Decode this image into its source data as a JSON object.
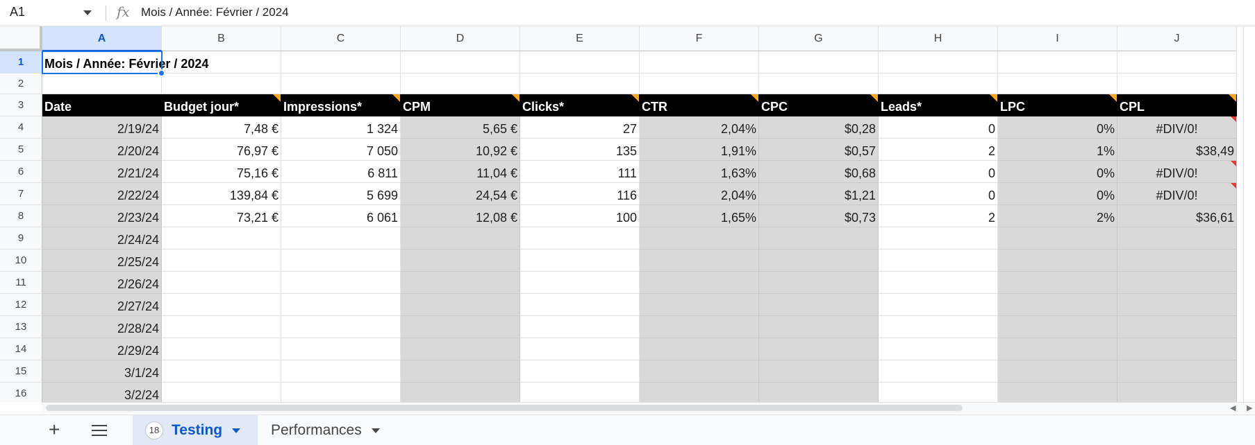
{
  "formula_bar": {
    "name_box": "A1",
    "fx_label": "fx",
    "formula": "Mois / Année: Février / 2024"
  },
  "columns": [
    "A",
    "B",
    "C",
    "D",
    "E",
    "F",
    "G",
    "H",
    "I",
    "J"
  ],
  "row_numbers": [
    "1",
    "2",
    "3",
    "4",
    "5",
    "6",
    "7",
    "8",
    "9",
    "10",
    "11",
    "12",
    "13",
    "14",
    "15",
    "16"
  ],
  "sheet": {
    "title": "Mois / Année: Février / 2024",
    "headers": [
      "Date",
      "Budget jour*",
      "Impressions*",
      "CPM",
      "Clicks*",
      "CTR",
      "CPC",
      "Leads*",
      "LPC",
      "CPL"
    ],
    "rows": [
      [
        "2/19/24",
        "7,48 €",
        "1 324",
        "5,65 €",
        "27",
        "2,04%",
        "$0,28",
        "0",
        "0%",
        "#DIV/0!"
      ],
      [
        "2/20/24",
        "76,97 €",
        "7 050",
        "10,92 €",
        "135",
        "1,91%",
        "$0,57",
        "2",
        "1%",
        "$38,49"
      ],
      [
        "2/21/24",
        "75,16 €",
        "6 811",
        "11,04 €",
        "111",
        "1,63%",
        "$0,68",
        "0",
        "0%",
        "#DIV/0!"
      ],
      [
        "2/22/24",
        "139,84 €",
        "5 699",
        "24,54 €",
        "116",
        "2,04%",
        "$1,21",
        "0",
        "0%",
        "#DIV/0!"
      ],
      [
        "2/23/24",
        "73,21 €",
        "6 061",
        "12,08 €",
        "100",
        "1,65%",
        "$0,73",
        "2",
        "2%",
        "$36,61"
      ],
      [
        "2/24/24",
        "",
        "",
        "",
        "",
        "",
        "",
        "",
        "",
        ""
      ],
      [
        "2/25/24",
        "",
        "",
        "",
        "",
        "",
        "",
        "",
        "",
        ""
      ],
      [
        "2/26/24",
        "",
        "",
        "",
        "",
        "",
        "",
        "",
        "",
        ""
      ],
      [
        "2/27/24",
        "",
        "",
        "",
        "",
        "",
        "",
        "",
        "",
        ""
      ],
      [
        "2/28/24",
        "",
        "",
        "",
        "",
        "",
        "",
        "",
        "",
        ""
      ],
      [
        "2/29/24",
        "",
        "",
        "",
        "",
        "",
        "",
        "",
        "",
        ""
      ],
      [
        "3/1/24",
        "",
        "",
        "",
        "",
        "",
        "",
        "",
        "",
        ""
      ],
      [
        "3/2/24",
        "",
        "",
        "",
        "",
        "",
        "",
        "",
        "",
        ""
      ]
    ]
  },
  "sheet_tabs": {
    "add_icon": "plus-icon",
    "list_icon": "hamburger-icon",
    "tabs": [
      {
        "label": "Testing",
        "count": "18",
        "active": true
      },
      {
        "label": "Performances",
        "active": false
      }
    ]
  },
  "colors": {
    "header_bg": "#000000",
    "header_text": "#ffffff",
    "calc_column_bg": "#d9d9d9",
    "note_marker": "#f5a623",
    "error_marker": "#e53935",
    "selection": "#1a73e8"
  }
}
